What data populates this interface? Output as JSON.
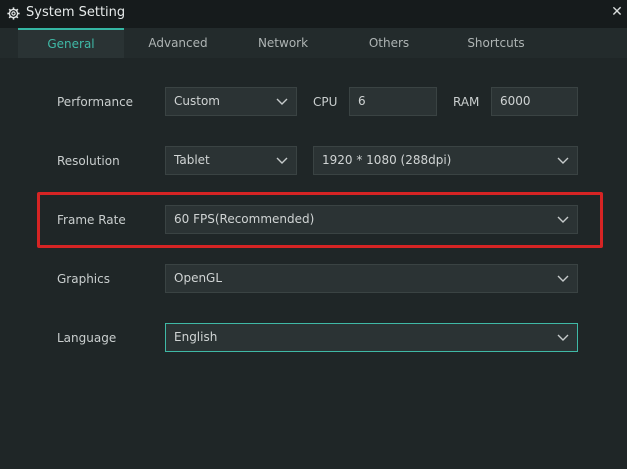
{
  "window": {
    "title": "System Setting",
    "close_glyph": "✕"
  },
  "tabs": [
    {
      "label": "General",
      "active": true
    },
    {
      "label": "Advanced",
      "active": false
    },
    {
      "label": "Network",
      "active": false
    },
    {
      "label": "Others",
      "active": false
    },
    {
      "label": "Shortcuts",
      "active": false
    }
  ],
  "performance": {
    "label": "Performance",
    "mode": "Custom",
    "cpu_label": "CPU",
    "cpu_value": "6",
    "ram_label": "RAM",
    "ram_value": "6000"
  },
  "resolution": {
    "label": "Resolution",
    "device": "Tablet",
    "size": "1920 * 1080 (288dpi)"
  },
  "frame_rate": {
    "label": "Frame Rate",
    "value": "60 FPS(Recommended)"
  },
  "graphics": {
    "label": "Graphics",
    "value": "OpenGL"
  },
  "language": {
    "label": "Language",
    "value": "English"
  },
  "colors": {
    "accent": "#3fb9a6",
    "highlight": "#d62424",
    "background": "#1f2627"
  }
}
